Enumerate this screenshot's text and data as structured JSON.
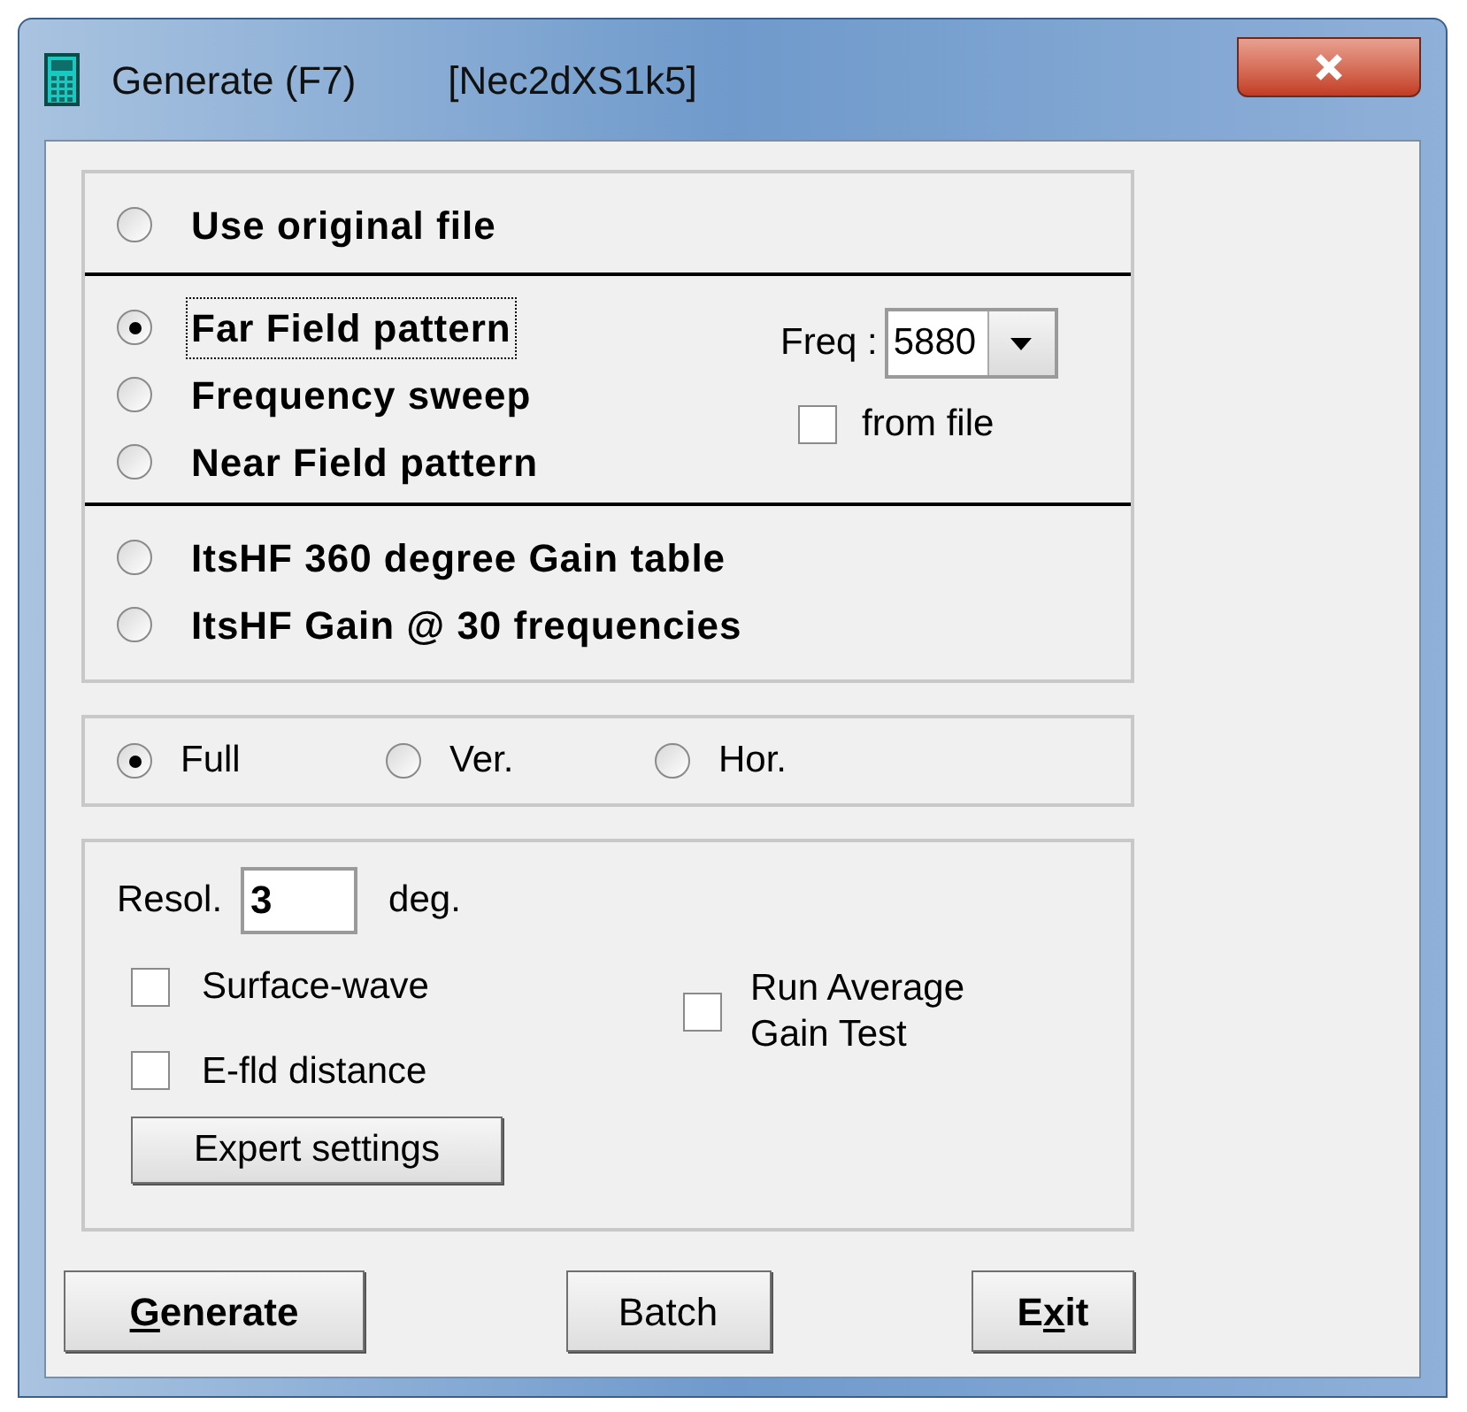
{
  "window": {
    "title": "Generate (F7)",
    "subtitle": "[Nec2dXS1k5]"
  },
  "output": {
    "sections": [
      {
        "options": [
          {
            "label": "Use original file",
            "selected": false,
            "focused": false
          }
        ]
      },
      {
        "options": [
          {
            "label": "Far Field pattern",
            "selected": true,
            "focused": true
          },
          {
            "label": "Frequency sweep",
            "selected": false,
            "focused": false
          },
          {
            "label": "Near Field pattern",
            "selected": false,
            "focused": false
          }
        ],
        "freq": {
          "label": "Freq :",
          "value": "5880"
        },
        "from_file": {
          "label": "from file",
          "checked": false
        }
      },
      {
        "options": [
          {
            "label": "ItsHF 360 degree Gain table",
            "selected": false,
            "focused": false
          },
          {
            "label": "ItsHF Gain @ 30 frequencies",
            "selected": false,
            "focused": false
          }
        ]
      }
    ]
  },
  "plane": [
    {
      "label": "Full",
      "selected": true
    },
    {
      "label": "Ver.",
      "selected": false
    },
    {
      "label": "Hor.",
      "selected": false
    }
  ],
  "settings": {
    "resol_label": "Resol.",
    "resol_value": "3",
    "resol_unit": "deg.",
    "checkboxes": [
      {
        "label": "Surface-wave",
        "checked": false
      },
      {
        "label": "E-fld distance",
        "checked": false
      }
    ],
    "average": {
      "label": "Run Average Gain Test",
      "checked": false
    },
    "expert_button": "Expert settings"
  },
  "buttons": [
    {
      "parts": [
        {
          "text": "G",
          "underline": true
        },
        {
          "text": "enerate",
          "underline": false
        }
      ],
      "bold": true
    },
    {
      "parts": [
        {
          "text": "Batch",
          "underline": false
        }
      ],
      "bold": false
    },
    {
      "parts": [
        {
          "text": "E",
          "underline": false
        },
        {
          "text": "x",
          "underline": true
        },
        {
          "text": "it",
          "underline": false
        }
      ],
      "bold": true
    }
  ]
}
